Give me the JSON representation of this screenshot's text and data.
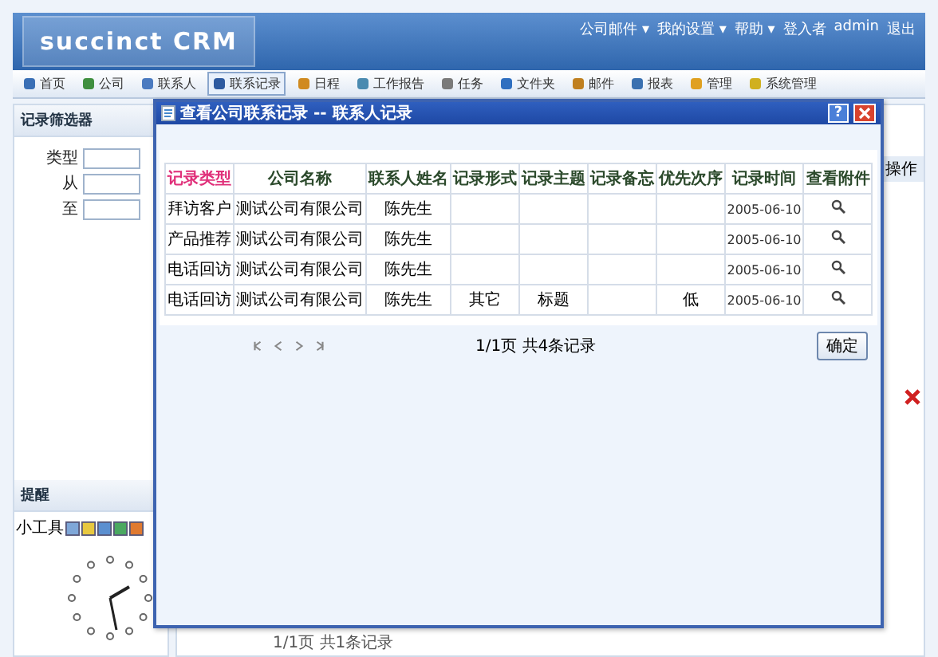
{
  "header": {
    "logo": "succinct CRM",
    "links": [
      "公司邮件 ▾",
      "我的设置 ▾",
      "帮助 ▾",
      "登入者",
      "admin",
      "退出"
    ]
  },
  "nav": [
    {
      "label": "首页",
      "selected": false
    },
    {
      "label": "公司",
      "selected": false
    },
    {
      "label": "联系人",
      "selected": false
    },
    {
      "label": "联系记录",
      "selected": true
    },
    {
      "label": "日程",
      "selected": false
    },
    {
      "label": "工作报告",
      "selected": false
    },
    {
      "label": "任务",
      "selected": false
    },
    {
      "label": "文件夹",
      "selected": false
    },
    {
      "label": "邮件",
      "selected": false
    },
    {
      "label": "报表",
      "selected": false
    },
    {
      "label": "管理",
      "selected": false
    },
    {
      "label": "系统管理",
      "selected": false
    }
  ],
  "filter_panel": {
    "title": "记录筛选器",
    "fields": [
      {
        "label": "类型"
      },
      {
        "label": "从"
      },
      {
        "label": "至"
      }
    ]
  },
  "widgets": {
    "title": "提醒",
    "toolbar_label": "小工具"
  },
  "background_list": {
    "column": "操作",
    "footer": "1/1页 共1条记录"
  },
  "dialog": {
    "title": "查看公司联系记录 -- 联系人记录",
    "help_button": "?",
    "columns": [
      {
        "label": "记录类型",
        "sorted": true
      },
      {
        "label": "公司名称",
        "sorted": false
      },
      {
        "label": "联系人姓名",
        "sorted": false
      },
      {
        "label": "记录形式",
        "sorted": false
      },
      {
        "label": "记录主题",
        "sorted": false
      },
      {
        "label": "记录备忘",
        "sorted": false
      },
      {
        "label": "优先次序",
        "sorted": false
      },
      {
        "label": "记录时间",
        "sorted": false
      },
      {
        "label": "查看附件",
        "sorted": false
      }
    ],
    "rows": [
      {
        "cells": [
          "拜访客户",
          "测试公司有限公司",
          "陈先生",
          "",
          "",
          "",
          "",
          "2005-06-10"
        ]
      },
      {
        "cells": [
          "产品推荐",
          "测试公司有限公司",
          "陈先生",
          "",
          "",
          "",
          "",
          "2005-06-10"
        ]
      },
      {
        "cells": [
          "电话回访",
          "测试公司有限公司",
          "陈先生",
          "",
          "",
          "",
          "",
          "2005-06-10"
        ]
      },
      {
        "cells": [
          "电话回访",
          "测试公司有限公司",
          "陈先生",
          "其它",
          "标题",
          "",
          "低",
          "2005-06-10"
        ]
      }
    ],
    "summary": "1/1页 共4条记录",
    "button": "确定"
  }
}
